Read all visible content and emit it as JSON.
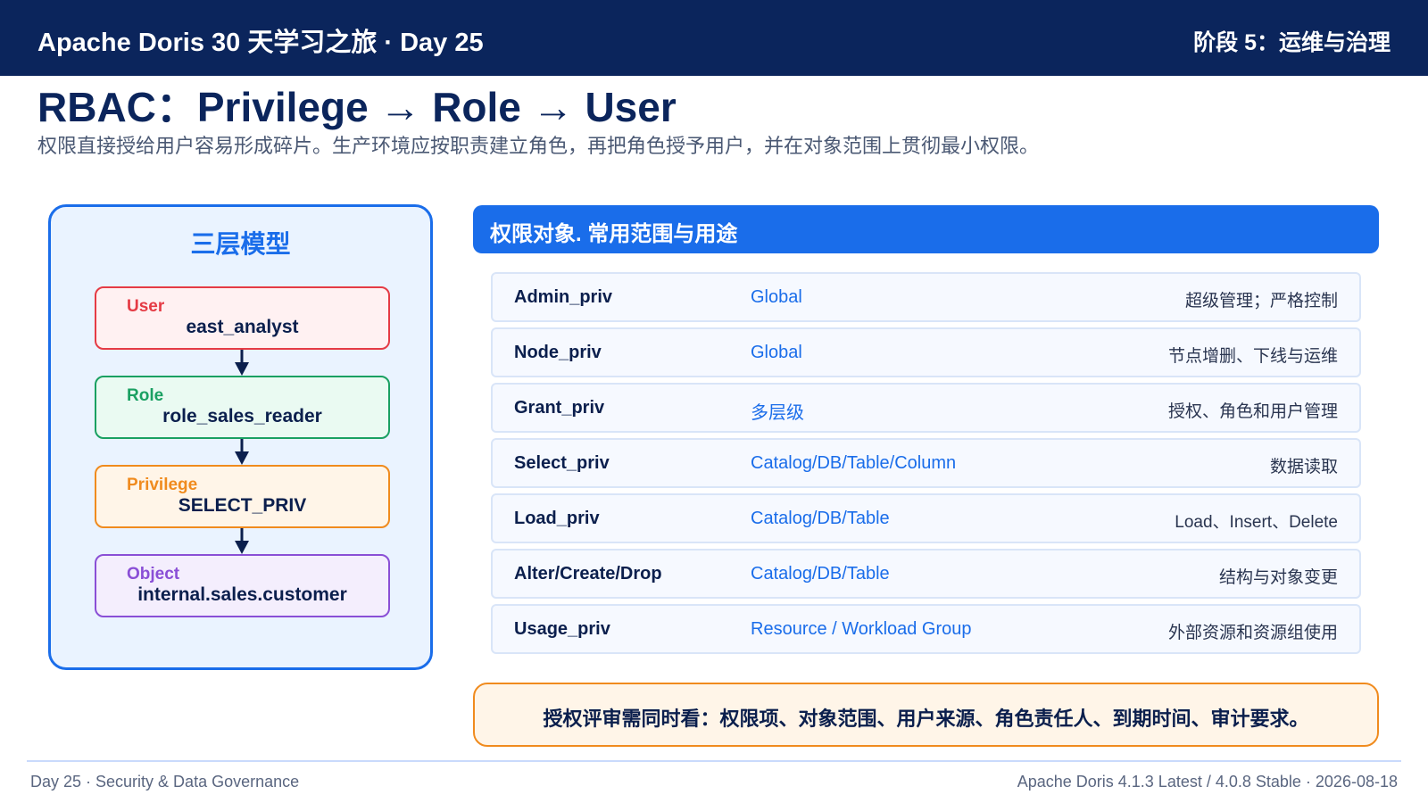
{
  "header": {
    "title": "Apache Doris 30 天学习之旅 · Day 25",
    "stage": "阶段 5：运维与治理"
  },
  "page": {
    "title": "RBAC：Privilege → Role → User",
    "subtitle": "权限直接授给用户容易形成碎片。生产环境应按职责建立角色，再把角色授予用户，并在对象范围上贯彻最小权限。"
  },
  "model": {
    "title": "三层模型",
    "nodes": [
      {
        "kind": "User",
        "value": "east_analyst"
      },
      {
        "kind": "Role",
        "value": "role_sales_reader"
      },
      {
        "kind": "Privilege",
        "value": "SELECT_PRIV"
      },
      {
        "kind": "Object",
        "value": "internal.sales.customer"
      }
    ]
  },
  "privileges": {
    "header": "权限对象. 常用范围与用途",
    "rows": [
      {
        "name": "Admin_priv",
        "scope": "Global",
        "usage": "超级管理；严格控制"
      },
      {
        "name": "Node_priv",
        "scope": "Global",
        "usage": "节点增删、下线与运维"
      },
      {
        "name": "Grant_priv",
        "scope": "多层级",
        "usage": "授权、角色和用户管理"
      },
      {
        "name": "Select_priv",
        "scope": "Catalog/DB/Table/Column",
        "usage": "数据读取"
      },
      {
        "name": "Load_priv",
        "scope": "Catalog/DB/Table",
        "usage": "Load、Insert、Delete"
      },
      {
        "name": "Alter/Create/Drop",
        "scope": "Catalog/DB/Table",
        "usage": "结构与对象变更"
      },
      {
        "name": "Usage_priv",
        "scope": "Resource / Workload Group",
        "usage": "外部资源和资源组使用"
      }
    ]
  },
  "note": "授权评审需同时看：权限项、对象范围、用户来源、角色责任人、到期时间、审计要求。",
  "footer": {
    "left": "Day 25 · Security & Data Governance",
    "right": "Apache Doris 4.1.3 Latest / 4.0.8 Stable · 2026-08-18"
  },
  "colors": {
    "navy": "#0b255c",
    "accent_blue": "#1a6dea",
    "user_red": "#e53b45",
    "role_green": "#1aa062",
    "privilege_orange": "#f08b1e",
    "object_purple": "#8a4fd6"
  }
}
